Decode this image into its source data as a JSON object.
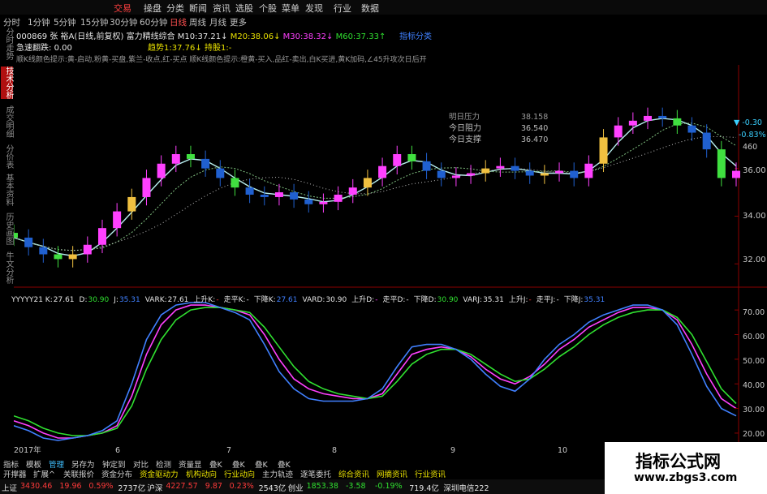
{
  "top_menu": {
    "items": [
      "交易",
      "操盘",
      "分类",
      "断闻",
      "资讯",
      "选股",
      "个股",
      "菜单",
      "发现",
      "行业",
      "数据"
    ],
    "active_index": 0
  },
  "periods": {
    "items": [
      "分时",
      "1分钟",
      "5分钟",
      "15分钟",
      "30分钟",
      "60分钟",
      "日线",
      "周线",
      "月线",
      "更多"
    ],
    "selected_index": 6
  },
  "side_tabs": {
    "items": [
      "分时走势",
      "技术分析",
      "成交明细",
      "分价表",
      "基本资料",
      "历史画图",
      "牛文分析"
    ],
    "selected_index": 1
  },
  "header": {
    "code": "000869",
    "name_line": "张 裕A(日线,前复权)",
    "indicator_name": "富力精线综合",
    "ma_items": [
      {
        "label": "M10:",
        "value": "37.21↓",
        "color": "#e6e6e6"
      },
      {
        "label": "M20:",
        "value": "38.06↓",
        "color": "#e8e000"
      },
      {
        "label": "M30:",
        "value": "38.32↓",
        "color": "#ff40ff"
      },
      {
        "label": "M60:",
        "value": "37.33↑",
        "color": "#30e030"
      }
    ],
    "right_label": "指标分类",
    "row2_label": "急速翻跌:",
    "row2_value": "0.00",
    "row2_trend_label": "趋势1:",
    "row2_trend_value": "37.76↓",
    "row2_hold_label": "持股1:",
    "row2_hold_value": "-",
    "hint": "顺K线颜色提示:黄-启动,粉黄-买盘,紫兰-收点,红-买点 顺K线颜色提示:橙黄-买入,品红-卖出,白K买进,黄K加码,∠45升攻次日后开"
  },
  "price_panel": {
    "y_ticks": [
      "36.00",
      "34.00",
      "32.00"
    ],
    "right_pct_1": "-0.30",
    "right_pct_2": "-0.83%",
    "right_num": "460",
    "popup": [
      {
        "label": "明日压力",
        "value": "38.158"
      },
      {
        "label": "今日阻力",
        "value": "36.540"
      },
      {
        "label": "今日支撑",
        "value": "36.470"
      }
    ]
  },
  "kdj_header": {
    "items": [
      {
        "text": "YYYYY21 K:",
        "value": "27.61",
        "color": "#e6e6e6"
      },
      {
        "text": "D:",
        "value": "30.90",
        "color": "#30e030"
      },
      {
        "text": "J:",
        "value": "35.31",
        "color": "#4080ff"
      },
      {
        "text": "VARK:",
        "value": "27.61",
        "color": "#e6e6e6"
      },
      {
        "text": "上升K:",
        "value": "-",
        "color": "#ff3a3a"
      },
      {
        "text": "走平K:",
        "value": "-",
        "color": "#e6e6e6"
      },
      {
        "text": "下降K:",
        "value": "27.61",
        "color": "#4080ff"
      },
      {
        "text": "VARD:",
        "value": "30.90",
        "color": "#e6e6e6"
      },
      {
        "text": "上升D:",
        "value": "-",
        "color": "#ff40ff"
      },
      {
        "text": "走平D:",
        "value": "-",
        "color": "#e6e6e6"
      },
      {
        "text": "下降D:",
        "value": "30.90",
        "color": "#30e030"
      },
      {
        "text": "VARJ:",
        "value": "35.31",
        "color": "#e6e6e6"
      },
      {
        "text": "上升J:",
        "value": "-",
        "color": "#ff3a3a"
      },
      {
        "text": "走平J:",
        "value": "-",
        "color": "#e6e6e6"
      },
      {
        "text": "下降J:",
        "value": "35.31",
        "color": "#4080ff"
      }
    ]
  },
  "kdj_panel": {
    "y_ticks": [
      "70.00",
      "60.00",
      "50.00",
      "40.00",
      "30.00",
      "20.00"
    ]
  },
  "x_axis": {
    "labels": [
      "2017年",
      "6",
      "7",
      "8",
      "9",
      "10"
    ]
  },
  "bottom_tabs": {
    "items": [
      "指标",
      "模板",
      "管理",
      "另存为",
      "钟定到",
      "对比",
      "检测",
      "资量显",
      "叠K",
      "叠K",
      "叠K",
      "叠K"
    ],
    "selected_index": 2
  },
  "bottom_bar2": {
    "items": [
      {
        "text": "开撑器",
        "color": "#cfcfcf"
      },
      {
        "text": "扩展^",
        "color": "#cfcfcf"
      },
      {
        "text": "关联报价",
        "color": "#cfcfcf"
      },
      {
        "text": "资金分布",
        "color": "#cfcfcf"
      },
      {
        "text": "资金驱动力",
        "color": "#e8e000"
      },
      {
        "text": "机构动向",
        "color": "#e8e000"
      },
      {
        "text": "行业动向",
        "color": "#e8e000"
      },
      {
        "text": "主力轨迹",
        "color": "#cfcfcf"
      },
      {
        "text": "逐笔委托",
        "color": "#cfcfcf"
      },
      {
        "text": "综合资讯",
        "color": "#e8e000"
      },
      {
        "text": "网摘资讯",
        "color": "#e8e000"
      },
      {
        "text": "行业资讯",
        "color": "#e8e000"
      }
    ]
  },
  "status_bar": {
    "items": [
      {
        "text": "上证",
        "color": "#e6e6e6"
      },
      {
        "text": "3430.46",
        "color": "#ff3a3a"
      },
      {
        "text": "19.96",
        "color": "#ff3a3a"
      },
      {
        "text": "0.59%",
        "color": "#ff3a3a"
      },
      {
        "text": "2737亿",
        "color": "#e6e6e6"
      },
      {
        "text": "沪深",
        "color": "#e6e6e6"
      },
      {
        "text": "4227.57",
        "color": "#ff3a3a"
      },
      {
        "text": "9.87",
        "color": "#ff3a3a"
      },
      {
        "text": "0.23%",
        "color": "#ff3a3a"
      },
      {
        "text": "2543亿",
        "color": "#e6e6e6"
      },
      {
        "text": "创业",
        "color": "#e6e6e6"
      },
      {
        "text": "1853.38",
        "color": "#30e030"
      },
      {
        "text": "-3.58",
        "color": "#30e030"
      },
      {
        "text": "-0.19%",
        "color": "#30e030"
      },
      {
        "text": "719.4亿",
        "color": "#e6e6e6"
      },
      {
        "text": "深圳电信222",
        "color": "#e6e6e6"
      }
    ]
  },
  "watermark": {
    "title": "指标公式网",
    "url": "www.zbgs3.com"
  },
  "chart_data": {
    "type": "line",
    "price_range": [
      31.5,
      38.3
    ],
    "kdj_range": [
      18,
      74
    ],
    "kdj_series": [
      {
        "name": "K",
        "color": "#ff40ff",
        "values": [
          25,
          23,
          20,
          18,
          18,
          19,
          20,
          23,
          35,
          52,
          64,
          70,
          72,
          72,
          71,
          70,
          68,
          60,
          50,
          42,
          38,
          36,
          35,
          34,
          34,
          36,
          44,
          52,
          54,
          55,
          54,
          51,
          46,
          42,
          40,
          43,
          48,
          54,
          58,
          63,
          66,
          69,
          71,
          71,
          70,
          66,
          56,
          44,
          34,
          30
        ]
      },
      {
        "name": "D",
        "color": "#30e030",
        "values": [
          27,
          25,
          22,
          20,
          19,
          19,
          20,
          22,
          31,
          46,
          58,
          66,
          70,
          71,
          71,
          70,
          69,
          63,
          55,
          47,
          41,
          38,
          36,
          35,
          34,
          35,
          41,
          48,
          52,
          54,
          54,
          52,
          48,
          44,
          41,
          42,
          46,
          51,
          55,
          60,
          64,
          67,
          69,
          70,
          70,
          67,
          60,
          49,
          38,
          32
        ]
      },
      {
        "name": "J",
        "color": "#4080ff",
        "values": [
          23,
          21,
          18,
          17,
          18,
          19,
          21,
          25,
          40,
          58,
          68,
          72,
          73,
          73,
          71,
          69,
          66,
          56,
          45,
          38,
          34,
          33,
          33,
          33,
          34,
          38,
          47,
          55,
          56,
          56,
          54,
          50,
          44,
          39,
          37,
          42,
          50,
          56,
          60,
          65,
          68,
          70,
          72,
          72,
          70,
          64,
          52,
          39,
          30,
          27
        ]
      }
    ],
    "price_close": [
      33.1,
      32.7,
      32.4,
      32.2,
      32.4,
      32.8,
      33.5,
      34.2,
      34.8,
      35.6,
      36.2,
      36.6,
      36.4,
      36.0,
      35.6,
      35.2,
      34.9,
      34.8,
      35.0,
      34.7,
      34.5,
      34.6,
      34.9,
      35.2,
      35.6,
      36.1,
      36.6,
      36.3,
      35.9,
      35.6,
      35.7,
      35.8,
      36.0,
      36.1,
      35.9,
      35.7,
      35.8,
      35.9,
      35.6,
      36.2,
      37.3,
      37.8,
      38.0,
      38.2,
      38.1,
      37.8,
      37.5,
      36.8,
      35.6,
      35.9
    ]
  }
}
